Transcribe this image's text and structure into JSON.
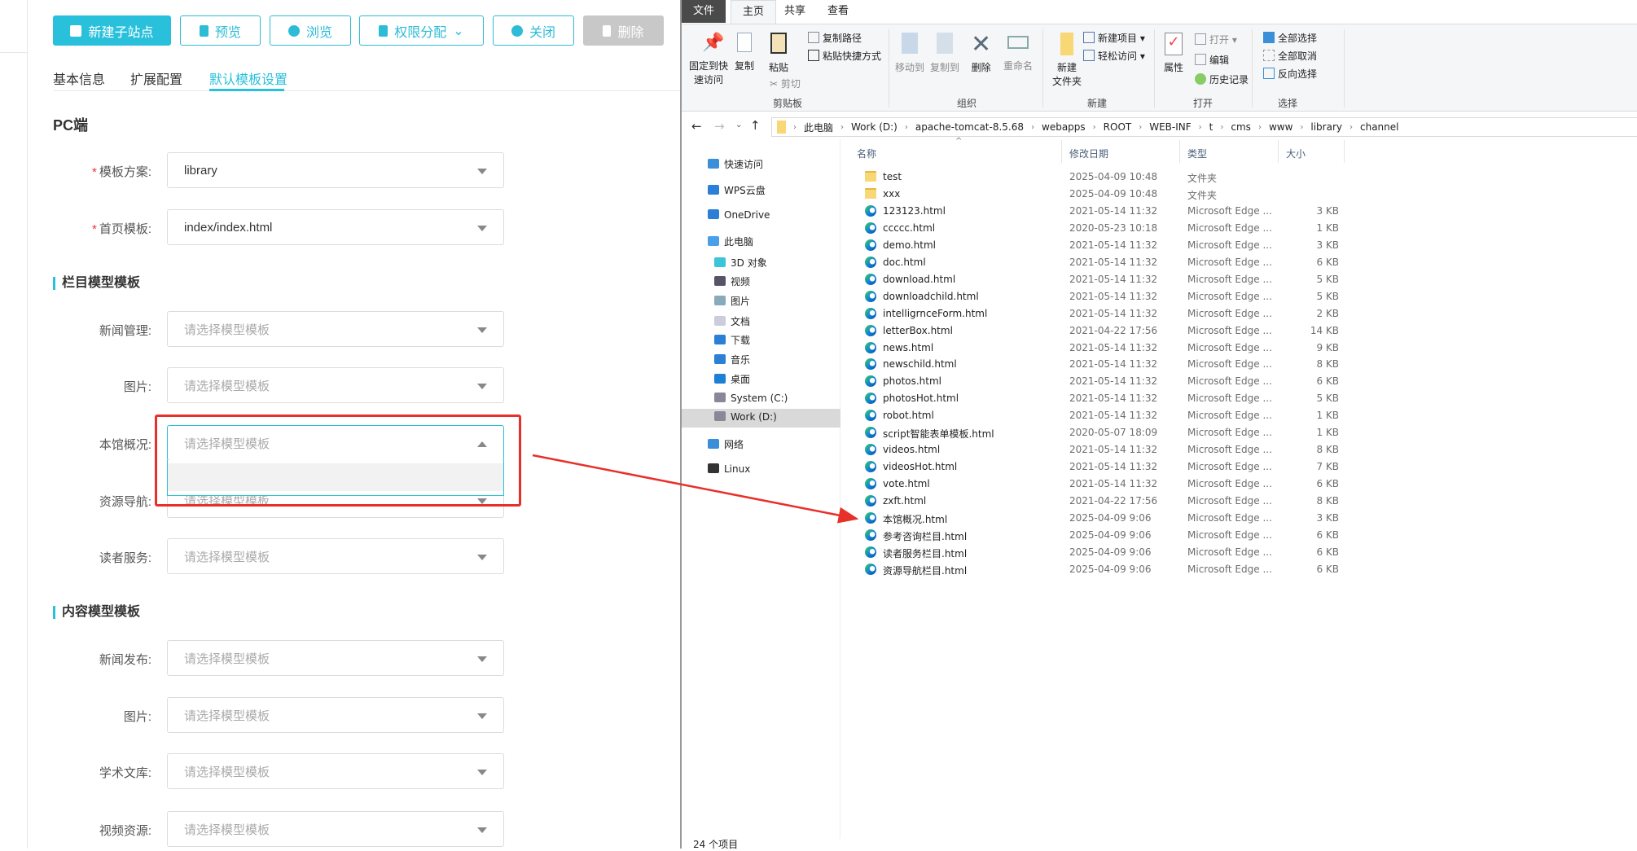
{
  "toolbar": {
    "new_site": "新建子站点",
    "preview": "预览",
    "browse": "浏览",
    "permissions": "权限分配",
    "close": "关闭",
    "delete": "删除"
  },
  "tabs": [
    "基本信息",
    "扩展配置",
    "默认模板设置"
  ],
  "pc_heading": "PC端",
  "top_fields": [
    {
      "label": "模板方案:",
      "value": "library"
    },
    {
      "label": "首页模板:",
      "value": "index/index.html"
    }
  ],
  "column_section": "栏目模型模板",
  "column_fields": [
    {
      "label": "新闻管理:",
      "placeholder": "请选择模型模板"
    },
    {
      "label": "图片:",
      "placeholder": "请选择模型模板"
    },
    {
      "label": "本馆概况:",
      "placeholder": "请选择模型模板"
    },
    {
      "label": "资源导航:",
      "placeholder": "请选择模型模板"
    },
    {
      "label": "读者服务:",
      "placeholder": "请选择模型模板"
    }
  ],
  "content_section": "内容模型模板",
  "content_fields": [
    {
      "label": "新闻发布:",
      "placeholder": "请选择模型模板"
    },
    {
      "label": "图片:",
      "placeholder": "请选择模型模板"
    },
    {
      "label": "学术文库:",
      "placeholder": "请选择模型模板"
    },
    {
      "label": "视频资源:",
      "placeholder": "请选择模型模板"
    }
  ],
  "colors": {
    "accent": "#29c0dc",
    "annotation": "#e8302a"
  },
  "explorer": {
    "tabs": [
      "文件",
      "主页",
      "共享",
      "查看"
    ],
    "ribbon": {
      "pin": "固定到快速访问",
      "pin1": "固定到快",
      "pin2": "速访问",
      "copy": "复制",
      "paste": "粘贴",
      "copy_path": "复制路径",
      "paste_shortcut": "粘贴快捷方式",
      "cut": "剪切",
      "clipboard": "剪贴板",
      "move_to": "移动到",
      "copy_to": "复制到",
      "delete": "删除",
      "rename": "重命名",
      "organize": "组织",
      "new_folder1": "新建",
      "new_folder2": "文件夹",
      "new_item": "新建项目",
      "easy_access": "轻松访问",
      "new": "新建",
      "properties": "属性",
      "open": "打开",
      "edit": "编辑",
      "history": "历史记录",
      "open_group": "打开",
      "select_all": "全部选择",
      "select_none": "全部取消",
      "invert": "反向选择",
      "select": "选择"
    },
    "breadcrumb": [
      "此电脑",
      "Work (D:)",
      "apache-tomcat-8.5.68",
      "webapps",
      "ROOT",
      "WEB-INF",
      "t",
      "cms",
      "www",
      "library",
      "channel"
    ],
    "nav": [
      {
        "label": "快速访问",
        "level": 0,
        "icon": "star-icon"
      },
      {
        "label": "WPS云盘",
        "level": 0,
        "icon": "cloud-icon"
      },
      {
        "label": "OneDrive",
        "level": 0,
        "icon": "cloud-icon"
      },
      {
        "label": "此电脑",
        "level": 0,
        "icon": "computer-icon"
      },
      {
        "label": "3D 对象",
        "level": 1,
        "icon": "cube-icon"
      },
      {
        "label": "视频",
        "level": 1,
        "icon": "video-icon"
      },
      {
        "label": "图片",
        "level": 1,
        "icon": "picture-icon"
      },
      {
        "label": "文档",
        "level": 1,
        "icon": "document-icon"
      },
      {
        "label": "下载",
        "level": 1,
        "icon": "download-icon"
      },
      {
        "label": "音乐",
        "level": 1,
        "icon": "music-icon"
      },
      {
        "label": "桌面",
        "level": 1,
        "icon": "desktop-icon"
      },
      {
        "label": "System (C:)",
        "level": 1,
        "icon": "drive-icon"
      },
      {
        "label": "Work (D:)",
        "level": 1,
        "icon": "drive-icon",
        "selected": true
      },
      {
        "label": "网络",
        "level": 0,
        "icon": "network-icon"
      },
      {
        "label": "Linux",
        "level": 0,
        "icon": "linux-icon"
      }
    ],
    "columns": {
      "name": "名称",
      "date": "修改日期",
      "type": "类型",
      "size": "大小"
    },
    "files": [
      {
        "name": "test",
        "date": "2025-04-09 10:48",
        "type": "文件夹",
        "size": "",
        "folder": true
      },
      {
        "name": "xxx",
        "date": "2025-04-09 10:48",
        "type": "文件夹",
        "size": "",
        "folder": true
      },
      {
        "name": "123123.html",
        "date": "2021-05-14 11:32",
        "type": "Microsoft Edge ...",
        "size": "3 KB"
      },
      {
        "name": "ccccc.html",
        "date": "2020-05-23 10:18",
        "type": "Microsoft Edge ...",
        "size": "1 KB"
      },
      {
        "name": "demo.html",
        "date": "2021-05-14 11:32",
        "type": "Microsoft Edge ...",
        "size": "3 KB"
      },
      {
        "name": "doc.html",
        "date": "2021-05-14 11:32",
        "type": "Microsoft Edge ...",
        "size": "6 KB"
      },
      {
        "name": "download.html",
        "date": "2021-05-14 11:32",
        "type": "Microsoft Edge ...",
        "size": "5 KB"
      },
      {
        "name": "downloadchild.html",
        "date": "2021-05-14 11:32",
        "type": "Microsoft Edge ...",
        "size": "5 KB"
      },
      {
        "name": "intelligrnceForm.html",
        "date": "2021-05-14 11:32",
        "type": "Microsoft Edge ...",
        "size": "2 KB"
      },
      {
        "name": "letterBox.html",
        "date": "2021-04-22 17:56",
        "type": "Microsoft Edge ...",
        "size": "14 KB"
      },
      {
        "name": "news.html",
        "date": "2021-05-14 11:32",
        "type": "Microsoft Edge ...",
        "size": "9 KB"
      },
      {
        "name": "newschild.html",
        "date": "2021-05-14 11:32",
        "type": "Microsoft Edge ...",
        "size": "8 KB"
      },
      {
        "name": "photos.html",
        "date": "2021-05-14 11:32",
        "type": "Microsoft Edge ...",
        "size": "6 KB"
      },
      {
        "name": "photosHot.html",
        "date": "2021-05-14 11:32",
        "type": "Microsoft Edge ...",
        "size": "5 KB"
      },
      {
        "name": "robot.html",
        "date": "2021-05-14 11:32",
        "type": "Microsoft Edge ...",
        "size": "1 KB"
      },
      {
        "name": "script智能表单模板.html",
        "date": "2020-05-07 18:09",
        "type": "Microsoft Edge ...",
        "size": "1 KB"
      },
      {
        "name": "videos.html",
        "date": "2021-05-14 11:32",
        "type": "Microsoft Edge ...",
        "size": "8 KB"
      },
      {
        "name": "videosHot.html",
        "date": "2021-05-14 11:32",
        "type": "Microsoft Edge ...",
        "size": "7 KB"
      },
      {
        "name": "vote.html",
        "date": "2021-05-14 11:32",
        "type": "Microsoft Edge ...",
        "size": "6 KB"
      },
      {
        "name": "zxft.html",
        "date": "2021-04-22 17:56",
        "type": "Microsoft Edge ...",
        "size": "8 KB"
      },
      {
        "name": "本馆概况.html",
        "date": "2025-04-09 9:06",
        "type": "Microsoft Edge ...",
        "size": "3 KB"
      },
      {
        "name": "参考咨询栏目.html",
        "date": "2025-04-09 9:06",
        "type": "Microsoft Edge ...",
        "size": "6 KB"
      },
      {
        "name": "读者服务栏目.html",
        "date": "2025-04-09 9:06",
        "type": "Microsoft Edge ...",
        "size": "6 KB"
      },
      {
        "name": "资源导航栏目.html",
        "date": "2025-04-09 9:06",
        "type": "Microsoft Edge ...",
        "size": "6 KB"
      }
    ],
    "status": "24 个项目"
  }
}
